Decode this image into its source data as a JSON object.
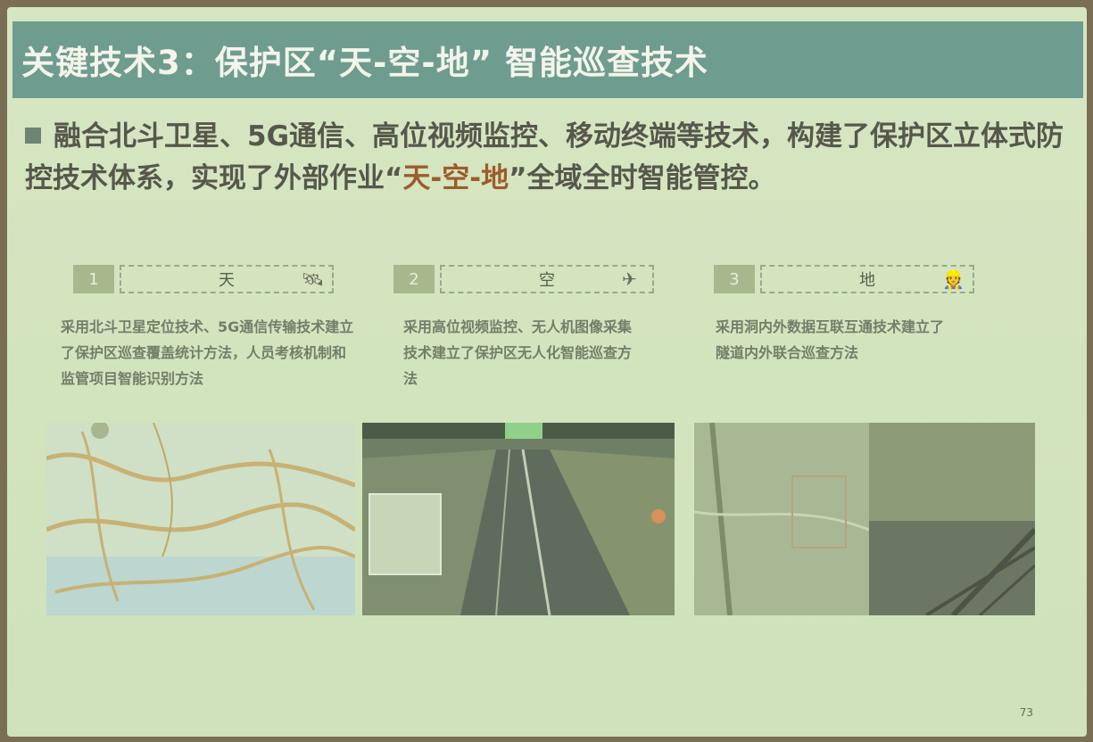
{
  "slide": {
    "title": "关键技术3：保护区“天-空-地” 智能巡查技术",
    "body_part1": "融合北斗卫星、5G通信、高位视频监控、移动终端等技术，构建了保护区立体式防控技术体系，实现了外部作业“",
    "body_highlight": "天-空-地",
    "body_part2": "”全域全时智能管控。",
    "page_number": "73"
  },
  "steps": [
    {
      "num": "1",
      "label": "天",
      "icon": "satellite-icon",
      "glyph": "🛰",
      "desc": "采用北斗卫星定位技术、5G通信传输技术建立了保护区巡查覆盖统计方法，人员考核机制和监管项目智能识别方法"
    },
    {
      "num": "2",
      "label": "空",
      "icon": "drone-icon",
      "glyph": "✈",
      "desc": "采用高位视频监控、无人机图像采集技术建立了保护区无人化智能巡查方法"
    },
    {
      "num": "3",
      "label": "地",
      "icon": "worker-icon",
      "glyph": "👷",
      "desc": "采用洞内外数据互联互通技术建立了隧道内外联合巡查方法"
    }
  ],
  "colors": {
    "title_bg": "#6e9c8e",
    "highlight": "#9c5c2b",
    "slide_bg": "#d3e4bf"
  }
}
